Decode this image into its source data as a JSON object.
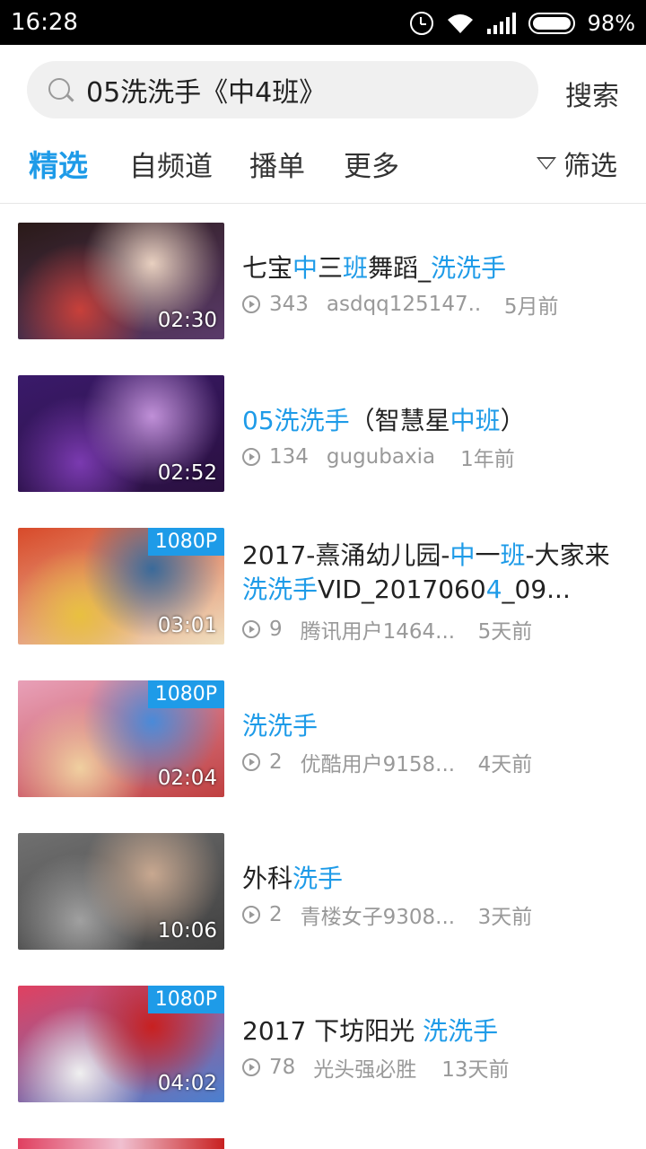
{
  "status_bar": {
    "time": "16:28",
    "battery": "98%"
  },
  "search": {
    "query": "05洗洗手《中4班》",
    "button_label": "搜索"
  },
  "tabs": [
    {
      "label": "精选",
      "active": true
    },
    {
      "label": "自频道",
      "active": false
    },
    {
      "label": "播单",
      "active": false
    },
    {
      "label": "更多",
      "active": false
    }
  ],
  "filter_label": "筛选",
  "results": [
    {
      "title_parts": [
        [
          "七宝",
          false
        ],
        [
          "中",
          true
        ],
        [
          "三",
          false
        ],
        [
          "班",
          true
        ],
        [
          "舞蹈_",
          false
        ],
        [
          "洗洗手",
          true
        ]
      ],
      "plays": "343",
      "uploader": "asdqq125147...",
      "time": "5月前",
      "duration": "02:30",
      "quality": "",
      "colors": [
        "#2a1a18",
        "#c8403a",
        "#e8d0c0",
        "#5a3a6a"
      ]
    },
    {
      "title_parts": [
        [
          "05洗洗手",
          true
        ],
        [
          "（智慧星",
          false
        ],
        [
          "中班",
          true
        ],
        [
          "）",
          false
        ]
      ],
      "plays": "134",
      "uploader": "gugubaxia",
      "time": "1年前",
      "duration": "02:52",
      "quality": "",
      "colors": [
        "#3a1a6a",
        "#7a3ab0",
        "#c090d8",
        "#2a1040"
      ]
    },
    {
      "title_parts": [
        [
          "2017-熹涌幼儿园-",
          false
        ],
        [
          "中",
          true
        ],
        [
          "一",
          false
        ],
        [
          "班",
          true
        ],
        [
          "-大家来",
          false
        ],
        [
          "洗洗手",
          true
        ],
        [
          "VID_2017060",
          false
        ],
        [
          "4",
          true
        ],
        [
          "_09...",
          false
        ]
      ],
      "plays": "9",
      "uploader": "腾讯用户1464...",
      "time": "5天前",
      "duration": "03:01",
      "quality": "1080P",
      "colors": [
        "#d84a2a",
        "#e8c040",
        "#3a6a9a",
        "#f0e0c0"
      ]
    },
    {
      "title_parts": [
        [
          "洗洗手",
          true
        ]
      ],
      "plays": "2",
      "uploader": "优酷用户9158...",
      "time": "4天前",
      "duration": "02:04",
      "quality": "1080P",
      "colors": [
        "#e8a0b8",
        "#f0d0a0",
        "#4a8ad8",
        "#c04040"
      ]
    },
    {
      "title_parts": [
        [
          "外科",
          false
        ],
        [
          "洗手",
          true
        ]
      ],
      "plays": "2",
      "uploader": "青楼女子9308...",
      "time": "3天前",
      "duration": "10:06",
      "quality": "",
      "colors": [
        "#707070",
        "#a0a0a0",
        "#c8a890",
        "#404040"
      ]
    },
    {
      "title_parts": [
        [
          "2017 下坊阳光 ",
          false
        ],
        [
          "洗洗手",
          true
        ]
      ],
      "plays": "78",
      "uploader": "光头强必胜",
      "time": "13天前",
      "duration": "04:02",
      "quality": "1080P",
      "colors": [
        "#e04060",
        "#f0f0f0",
        "#c82020",
        "#4a80d0"
      ]
    }
  ]
}
